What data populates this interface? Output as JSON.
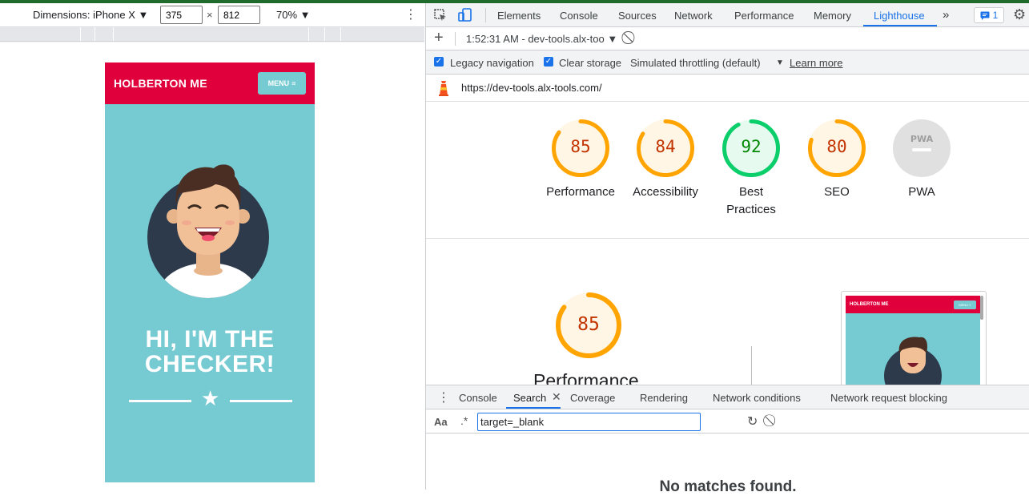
{
  "device_toolbar": {
    "dimensions_label": "Dimensions: iPhone X ▼",
    "width": "375",
    "times": "×",
    "height": "812",
    "zoom": "70% ▼",
    "more": "⋮"
  },
  "mobile_page": {
    "brand": "HOLBERTON ME",
    "menu_label": "MENU",
    "hero_line1": "HI, I'M THE",
    "hero_line2": "CHECKER!"
  },
  "devtools_tabs": {
    "items": [
      "Elements",
      "Console",
      "Sources",
      "Network",
      "Performance",
      "Memory",
      "Lighthouse"
    ],
    "active": "Lighthouse",
    "overflow": "»",
    "issues_count": "1"
  },
  "lighthouse": {
    "report_selector": "1:52:31 AM - dev-tools.alx-too ▼",
    "legacy_navigation": "Legacy navigation",
    "clear_storage": "Clear storage",
    "throttling": "Simulated throttling (default)",
    "learn_more": "Learn more",
    "url": "https://dev-tools.alx-tools.com/",
    "scores": [
      {
        "label": "Performance",
        "value": 85,
        "status": "average"
      },
      {
        "label": "Accessibility",
        "value": 84,
        "status": "average"
      },
      {
        "label": "Best Practices",
        "value": 92,
        "status": "pass"
      },
      {
        "label": "SEO",
        "value": 80,
        "status": "average"
      },
      {
        "label": "PWA",
        "value": null,
        "status": "na"
      }
    ],
    "pwa_badge": "PWA",
    "detail_score": "85",
    "detail_title": "Performance",
    "thumb_brand": "HOLBERTON ME",
    "thumb_menu": "MENU ≡",
    "colors": {
      "average": "#ffa400",
      "pass": "#0cce6b",
      "na": "#e0e0e0"
    }
  },
  "drawer": {
    "tabs": [
      "Console",
      "Search",
      "Coverage",
      "Rendering",
      "Network conditions",
      "Network request blocking"
    ],
    "active": "Search",
    "match_case": "Aa",
    "regex": ".*",
    "search_value": "target=_blank",
    "no_matches": "No matches found."
  }
}
